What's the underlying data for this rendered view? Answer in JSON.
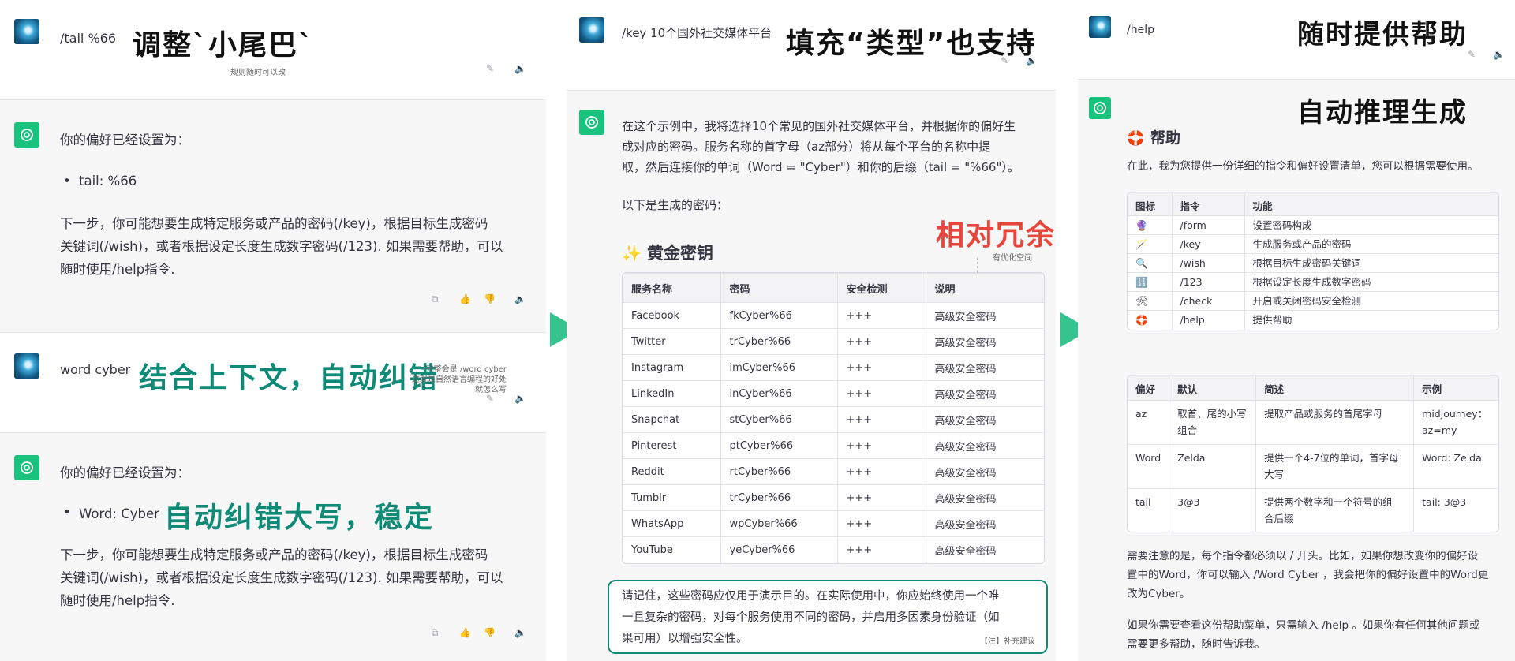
{
  "colors": {
    "accent_teal": "#0e8a76",
    "accent_red": "#e8453c",
    "arrow_green": "#35c48e",
    "bot_green": "#19c37d"
  },
  "panel1": {
    "msg1": {
      "text": "/tail %66",
      "annotation": "调整`小尾巴`",
      "note": "规则随时可以改"
    },
    "reply1": {
      "intro": "你的偏好已经设置为：",
      "bullet": "tail: %66",
      "body": [
        "下一步，你可能想要生成特定服务或产品的密码(/key)，根据目标生成密码",
        "关键词(/wish)，或者根据设定长度生成数字密码(/123). 如果需要帮助，可以",
        "随时使用/help指令."
      ]
    },
    "msg2": {
      "text": "word cyber",
      "annotation": "结合上下文，自动纠错",
      "note": [
        "完整会是 /word cyber",
        "这就是自然语言编程的好处",
        "就怎么写"
      ]
    },
    "reply2": {
      "intro": "你的偏好已经设置为：",
      "bullet": "Word: Cyber",
      "annotation": "自动纠错大写，稳定",
      "body": [
        "下一步，你可能想要生成特定服务或产品的密码(/key)，根据目标生成密码",
        "关键词(/wish)，或者根据设定长度生成数字密码(/123). 如果需要帮助，可以",
        "随时使用/help指令."
      ]
    }
  },
  "panel2": {
    "msg": {
      "text": "/key 10个国外社交媒体平台",
      "annotation": "填充“类型”也支持"
    },
    "reply": {
      "p1": [
        "在这个示例中，我将选择10个常见的国外社交媒体平台，并根据你的偏好生",
        "成对应的密码。服务名称的首字母（az部分）将从每个平台的名称中提",
        "取，然后连接你的单词（Word = \"Cyber\"）和你的后缀（tail = \"%66\"）。"
      ],
      "p2": "以下是生成的密码：",
      "heading_icon": "✨",
      "heading": "黄金密钥",
      "annotation": "相对冗余",
      "annotation_note": "有优化空间",
      "table": {
        "headers": [
          "服务名称",
          "密码",
          "安全检测",
          "说明"
        ],
        "rows": [
          [
            "Facebook",
            "fkCyber%66",
            "+++",
            "高级安全密码"
          ],
          [
            "Twitter",
            "trCyber%66",
            "+++",
            "高级安全密码"
          ],
          [
            "Instagram",
            "imCyber%66",
            "+++",
            "高级安全密码"
          ],
          [
            "LinkedIn",
            "lnCyber%66",
            "+++",
            "高级安全密码"
          ],
          [
            "Snapchat",
            "stCyber%66",
            "+++",
            "高级安全密码"
          ],
          [
            "Pinterest",
            "ptCyber%66",
            "+++",
            "高级安全密码"
          ],
          [
            "Reddit",
            "rtCyber%66",
            "+++",
            "高级安全密码"
          ],
          [
            "Tumblr",
            "trCyber%66",
            "+++",
            "高级安全密码"
          ],
          [
            "WhatsApp",
            "wpCyber%66",
            "+++",
            "高级安全密码"
          ],
          [
            "YouTube",
            "yeCyber%66",
            "+++",
            "高级安全密码"
          ]
        ]
      },
      "notice": [
        "请记住，这些密码应仅用于演示目的。在实际使用中，你应始终使用一个唯",
        "一且复杂的密码，对每个服务使用不同的密码，并启用多因素身份验证（如",
        "果可用）以增强安全性。"
      ],
      "notice_tag": "【注】补充建议"
    }
  },
  "panel3": {
    "msg": {
      "text": "/help",
      "annotation": "随时提供帮助"
    },
    "reply": {
      "annotation": "自动推理生成",
      "heading_icon": "🛟",
      "heading": "帮助",
      "intro": "在此，我为您提供一份详细的指令和偏好设置清单，您可以根据需要使用。",
      "cmd_table": {
        "headers": [
          "图标",
          "指令",
          "功能"
        ],
        "rows": [
          [
            "🔮",
            "/form",
            "设置密码构成"
          ],
          [
            "🪄",
            "/key",
            "生成服务或产品的密码"
          ],
          [
            "🔍",
            "/wish",
            "根据目标生成密码关键词"
          ],
          [
            "🔢",
            "/123",
            "根据设定长度生成数字密码"
          ],
          [
            "🛠",
            "/check",
            "开启或关闭密码安全检测"
          ],
          [
            "🛟",
            "/help",
            "提供帮助"
          ]
        ]
      },
      "pref_table": {
        "headers": [
          "偏好",
          "默认",
          "简述",
          "示例"
        ],
        "rows": [
          [
            "az",
            "取首、尾的小写\n组合",
            "提取产品或服务的首尾字母",
            "midjourney：\naz=my"
          ],
          [
            "Word",
            "Zelda",
            "提供一个4-7位的单词，首字母\n大写",
            "Word: Zelda"
          ],
          [
            "tail",
            "3@3",
            "提供两个数字和一个符号的组\n合后缀",
            "tail: 3@3"
          ]
        ]
      },
      "p1": [
        "需要注意的是，每个指令都必须以 / 开头。比如，如果你想改变你的偏好设",
        "置中的Word，你可以输入 /Word Cyber ，我会把你的偏好设置中的Word更",
        "改为Cyber。"
      ],
      "p2": [
        "如果你需要查看这份帮助菜单，只需输入 /help 。如果你有任何其他问题或",
        "需要更多帮助，随时告诉我。"
      ]
    }
  }
}
